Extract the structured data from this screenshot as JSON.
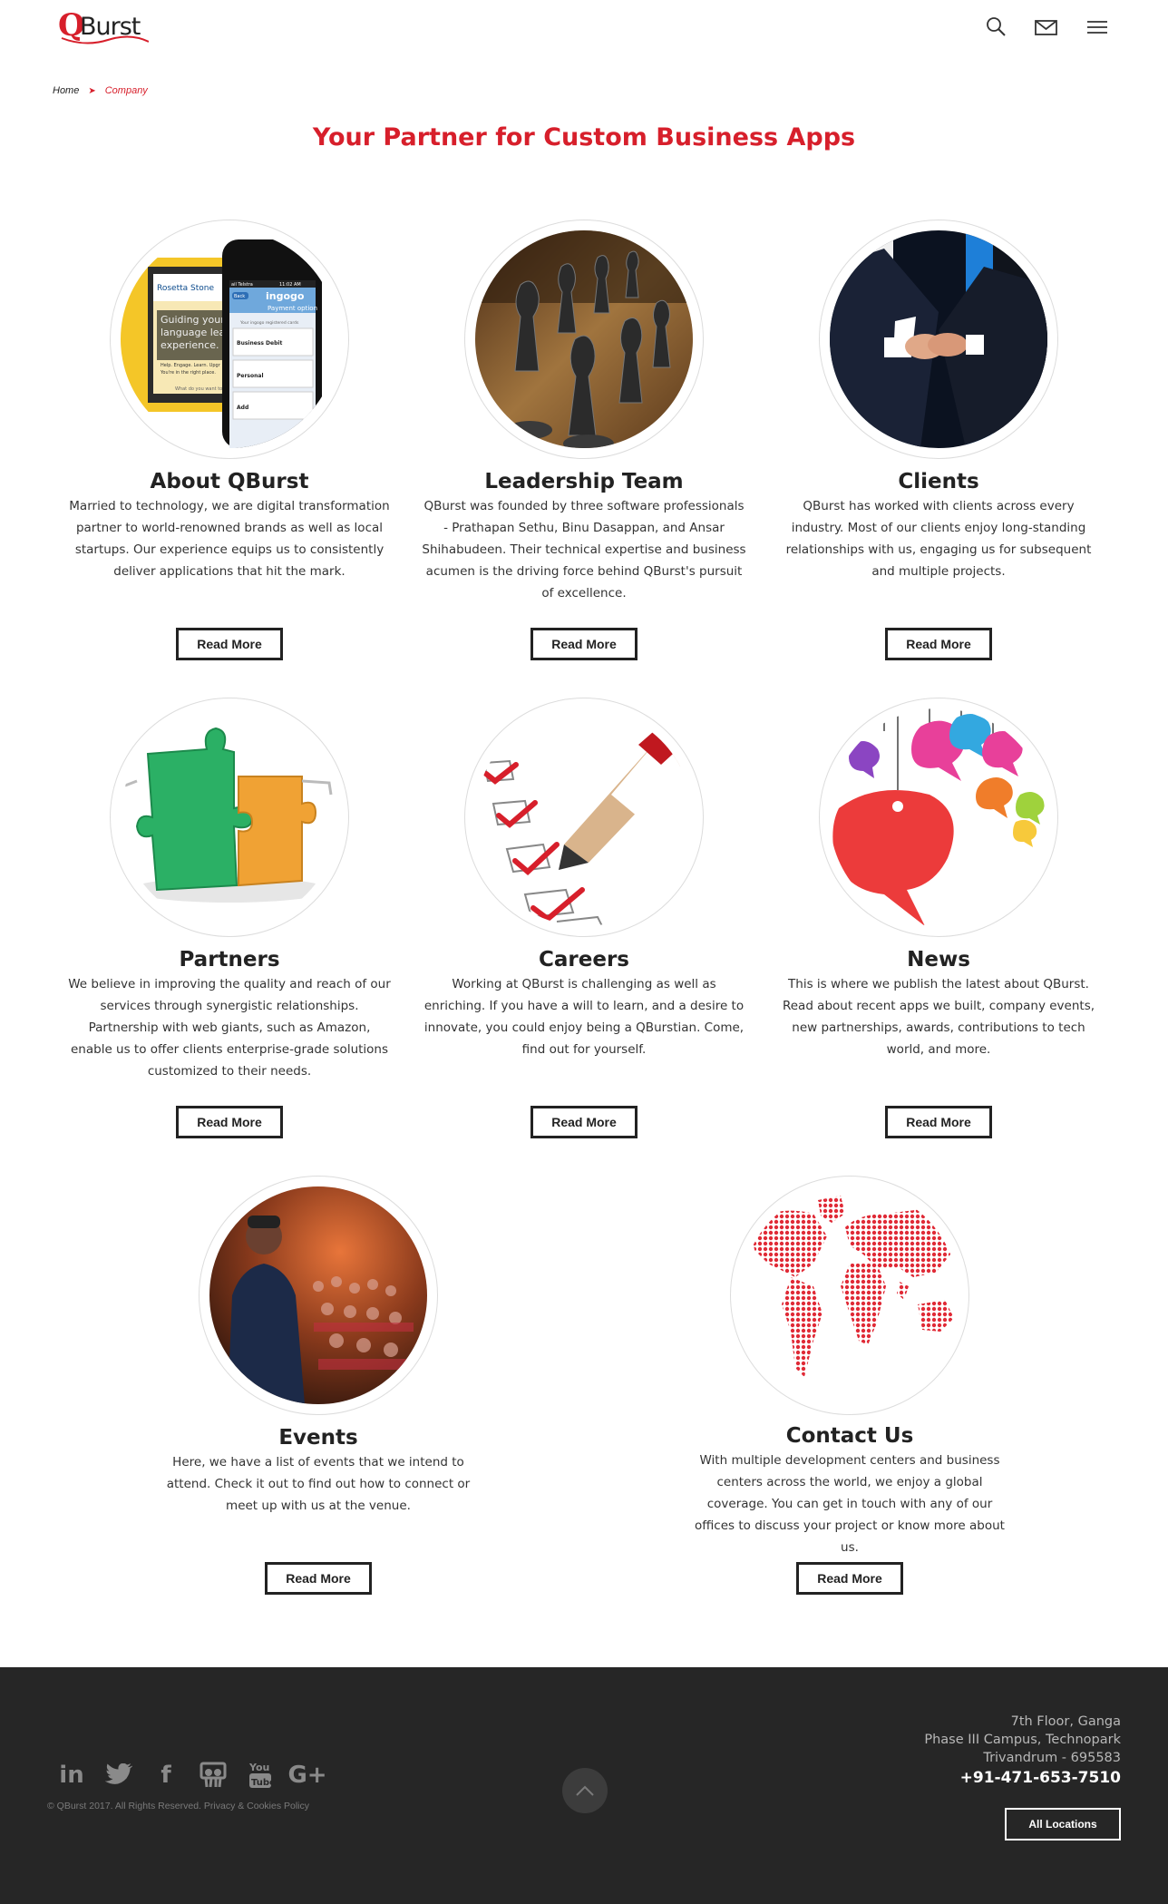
{
  "header": {
    "logo_q": "Q",
    "logo_text": "Burst",
    "icons": [
      "search-icon",
      "mail-icon",
      "menu-icon"
    ]
  },
  "breadcrumb": {
    "home": "Home",
    "separator": "➤",
    "current": "Company"
  },
  "page": {
    "title": "Your Partner for Custom Business Apps"
  },
  "cards": [
    {
      "title": "About QBurst",
      "desc": "Married to technology, we are digital transformation partner to world-renowned brands as well as local startups. Our experience equips us to consistently deliver applications that hit the mark.",
      "button": "Read More"
    },
    {
      "title": "Leadership Team",
      "desc": "QBurst was founded by three software professionals - Prathapan Sethu, Binu Dasappan, and Ansar Shihabudeen. Their technical expertise and business acumen is the driving force behind QBurst's pursuit of excellence.",
      "button": "Read More"
    },
    {
      "title": "Clients",
      "desc": "QBurst has worked with clients across every industry. Most of our clients enjoy long-standing relationships with us, engaging us for subsequent and multiple projects.",
      "button": "Read More"
    },
    {
      "title": "Partners",
      "desc": "We believe in improving the quality and reach of our services through synergistic relationships. Partnership with web giants, such as Amazon, enable us to offer clients enterprise-grade solutions customized to their needs.",
      "button": "Read More"
    },
    {
      "title": "Careers",
      "desc": "Working at QBurst is challenging as well as enriching. If you have a will to learn, and a desire to innovate, you could enjoy being a QBurstian. Come, find out for yourself.",
      "button": "Read More"
    },
    {
      "title": "News",
      "desc": "This is where we publish the latest about QBurst. Read about recent apps we built, company events, new partnerships, awards, contributions to tech world, and more.",
      "button": "Read More"
    },
    {
      "title": "Events",
      "desc": "Here, we have a list of events that we intend to attend. Check it out to find out how to connect or meet up with us at the venue.",
      "button": "Read More"
    },
    {
      "title": "Contact Us",
      "desc": "With multiple development centers and business centers across the world, we enjoy a global coverage. You can get in touch with any of our offices to discuss your project or know more about us.",
      "button": "Read More"
    }
  ],
  "phone_mockup": {
    "status_carrier": "ail Telstra",
    "status_time": "11:02 AM",
    "brand": "ingogo",
    "back": "Back",
    "screen_title": "Payment option",
    "screen_subtitle": "Your ingogo registered cards",
    "row_1": "Business Debit",
    "row_2": "Personal",
    "row_3": "Add",
    "ad_brand": "Rosetta Stone",
    "ad_line_1": "Guiding your",
    "ad_line_2": "language lear",
    "ad_line_3": "experience.",
    "ad_small_1": "Help. Engage. Learn. Upgr",
    "ad_small_2": "You're in the right place.",
    "ad_footer": "What do you want to l"
  },
  "footer": {
    "social": [
      "in",
      "🐦",
      "f",
      "S",
      "You",
      "G+"
    ],
    "social_icons": [
      "linkedin-icon",
      "twitter-icon",
      "facebook-icon",
      "slideshare-icon",
      "youtube-icon",
      "google-plus-icon"
    ],
    "copyright": "© QBurst 2017. All Rights Reserved. Privacy & Cookies Policy",
    "address_line_1": "7th Floor, Ganga",
    "address_line_2": "Phase III Campus, Technopark",
    "address_line_3": "Trivandrum - 695583",
    "phone": "+91-471-653-7510",
    "all_locations": "All Locations"
  },
  "colors": {
    "brand_red": "#d71f2b",
    "footer_bg": "#262626",
    "text_dark": "#222222"
  }
}
